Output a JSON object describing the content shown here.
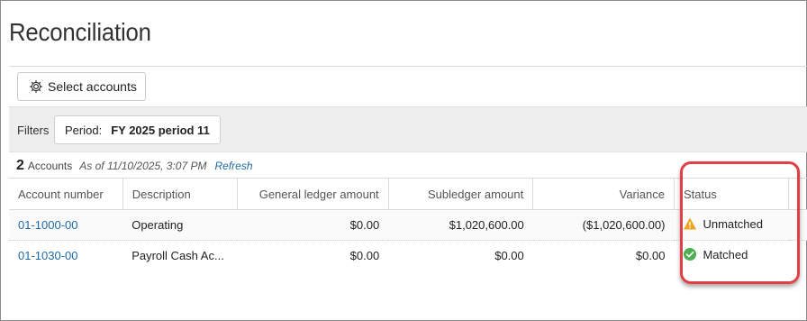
{
  "page": {
    "title": "Reconciliation"
  },
  "toolbar": {
    "select_accounts_label": "Select accounts"
  },
  "filters": {
    "label": "Filters",
    "period_label": "Period:",
    "period_value": "FY 2025 period 11"
  },
  "summary": {
    "count": "2",
    "count_label": "Accounts",
    "as_of": "As of 11/10/2025, 3:07 PM",
    "refresh_label": "Refresh"
  },
  "table": {
    "headers": [
      "Account number",
      "Description",
      "General ledger amount",
      "Subledger amount",
      "Variance",
      "Status"
    ],
    "rows": [
      {
        "account": "01-1000-00",
        "description": "Operating",
        "gl_amount": "$0.00",
        "subledger_amount": "$1,020,600.00",
        "variance": "($1,020,600.00)",
        "status": "Unmatched",
        "status_icon": "warning-icon"
      },
      {
        "account": "01-1030-00",
        "description": "Payroll Cash Ac...",
        "gl_amount": "$0.00",
        "subledger_amount": "$0.00",
        "variance": "$0.00",
        "status": "Matched",
        "status_icon": "check-circle-icon"
      }
    ]
  },
  "colors": {
    "link": "#1f6aa5",
    "warning": "#f0a31c",
    "success": "#4caf50",
    "highlight": "#e03f45"
  }
}
